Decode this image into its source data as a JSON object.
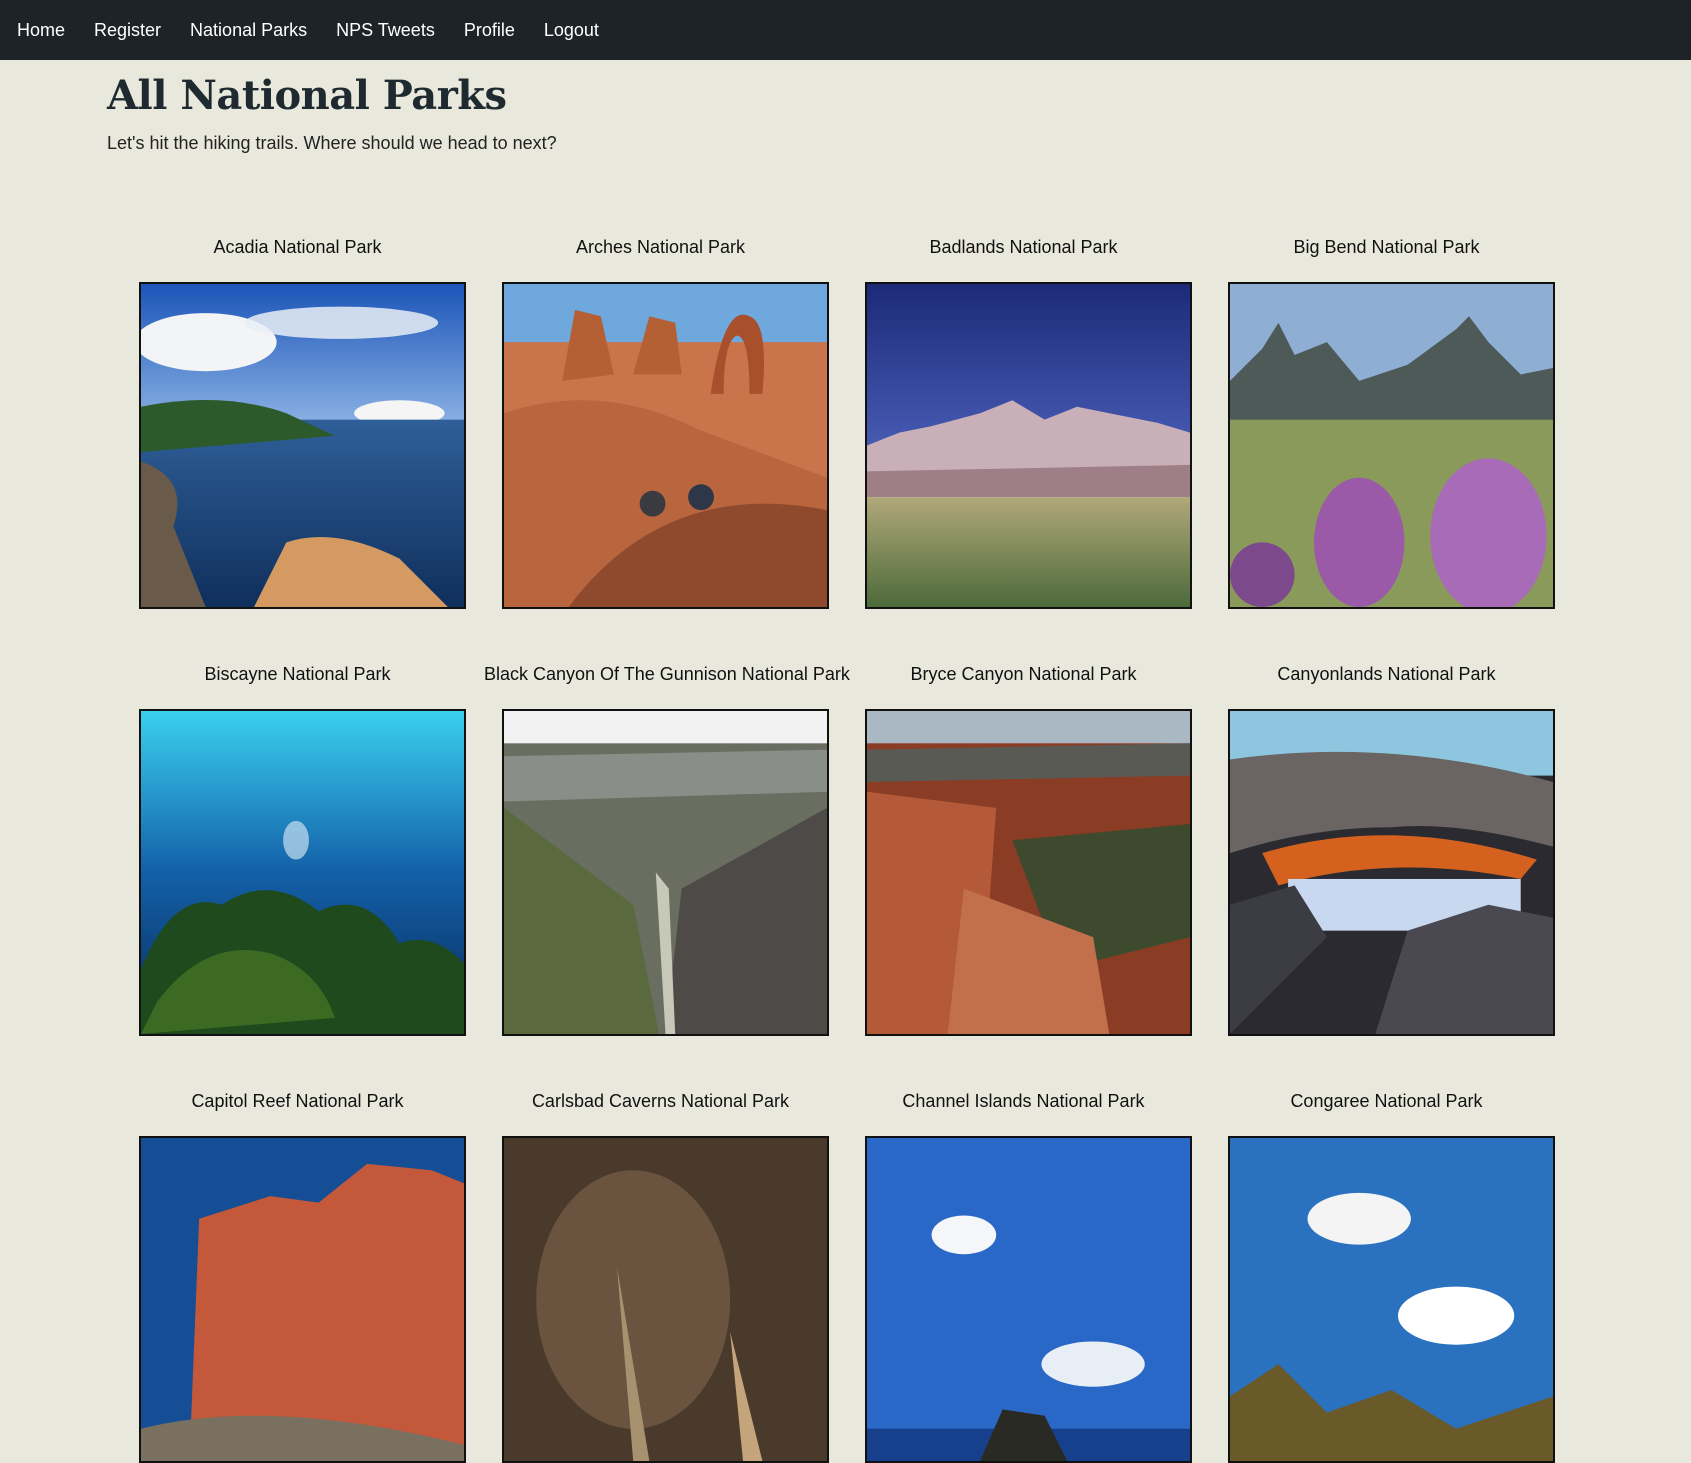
{
  "nav": {
    "items": [
      {
        "label": "Home"
      },
      {
        "label": "Register"
      },
      {
        "label": "National Parks"
      },
      {
        "label": "NPS Tweets"
      },
      {
        "label": "Profile"
      },
      {
        "label": "Logout"
      }
    ]
  },
  "header": {
    "title": "All National Parks",
    "subtitle": "Let's hit the hiking trails. Where should we head to next?"
  },
  "parks": [
    {
      "name": "Acadia National Park"
    },
    {
      "name": "Arches National Park"
    },
    {
      "name": "Badlands National Park"
    },
    {
      "name": "Big Bend National Park"
    },
    {
      "name": "Biscayne National Park"
    },
    {
      "name": "Black Canyon Of The Gunnison National Park"
    },
    {
      "name": "Bryce Canyon National Park"
    },
    {
      "name": "Canyonlands National Park"
    },
    {
      "name": "Capitol Reef National Park"
    },
    {
      "name": "Carlsbad Caverns National Park"
    },
    {
      "name": "Channel Islands National Park"
    },
    {
      "name": "Congaree National Park"
    }
  ]
}
